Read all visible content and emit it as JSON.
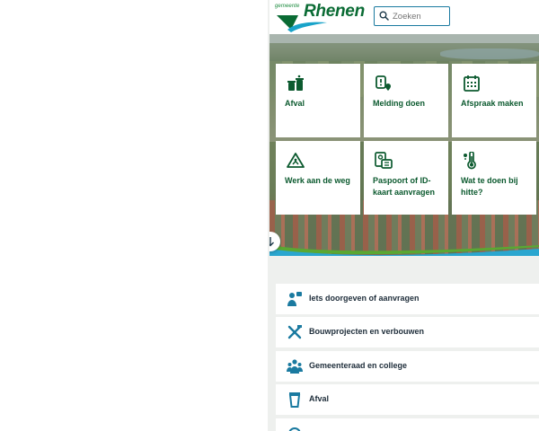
{
  "header": {
    "logo_small": "gemeente",
    "logo_name": "Rhenen",
    "search_placeholder": "Zoeken"
  },
  "tiles": [
    {
      "label": "Afval",
      "icon": "waste-bins-icon"
    },
    {
      "label": "Melding doen",
      "icon": "report-location-icon"
    },
    {
      "label": "Afspraak maken",
      "icon": "calendar-icon"
    },
    {
      "label": "Werk aan de weg",
      "icon": "roadwork-sign-icon"
    },
    {
      "label": "Paspoort of ID-kaart aanvragen",
      "icon": "id-card-icon"
    },
    {
      "label": "Wat te doen bij hitte?",
      "icon": "thermometer-icon"
    }
  ],
  "list": [
    {
      "label": "Iets doorgeven of aanvragen",
      "icon": "person-info-icon"
    },
    {
      "label": "Bouwprojecten en verbouwen",
      "icon": "tools-icon"
    },
    {
      "label": "Gemeenteraad en college",
      "icon": "council-icon"
    },
    {
      "label": "Afval",
      "icon": "waste-container-icon"
    }
  ],
  "colors": {
    "brand_green": "#0c5a2f",
    "accent_blue": "#1a7aa0",
    "list_text": "#1e2d3a",
    "background": "#eef0ee"
  }
}
